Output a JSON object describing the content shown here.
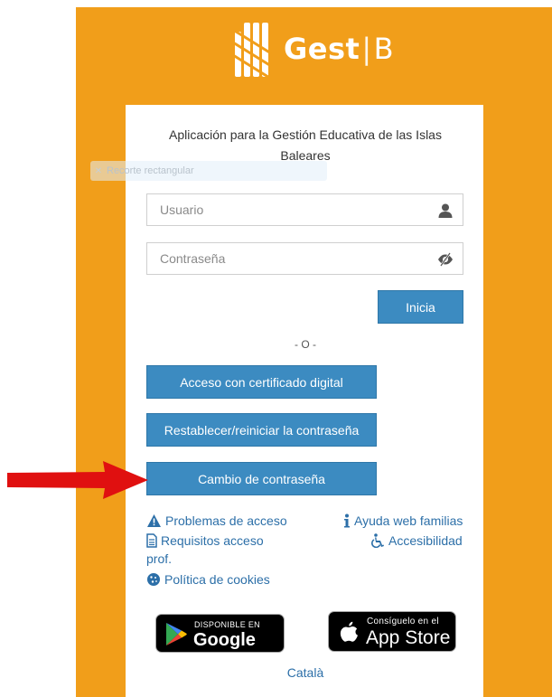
{
  "brand": {
    "name_bold": "Gest",
    "name_separator": "|",
    "name_light": "B"
  },
  "subtitle": "Aplicación para la Gestión Educativa de las Islas Baleares",
  "overlay": {
    "label": "Recorte rectangular"
  },
  "login": {
    "username_placeholder": "Usuario",
    "password_placeholder": "Contraseña",
    "submit_label": "Inicia"
  },
  "divider": "- O -",
  "buttons": {
    "certificate": "Acceso con certificado digital",
    "reset_password": "Restablecer/reiniciar la contraseña",
    "change_password": "Cambio de contraseña"
  },
  "links": {
    "access_problems": "Problemas de acceso",
    "help_families": "Ayuda web familias",
    "requirements_line1": "Requisitos acceso",
    "requirements_line2": "prof.",
    "accessibility": "Accesibilidad",
    "cookies": "Política de cookies"
  },
  "stores": {
    "google_small": "DISPONIBLE EN",
    "google_big": "Google Play",
    "apple_small": "Consíguelo en el",
    "apple_big": "App Store"
  },
  "language": "Català",
  "colors": {
    "accent": "#F19E1A",
    "button": "#3c8bc1",
    "link": "#2c6fa8",
    "arrow": "#e01010"
  }
}
